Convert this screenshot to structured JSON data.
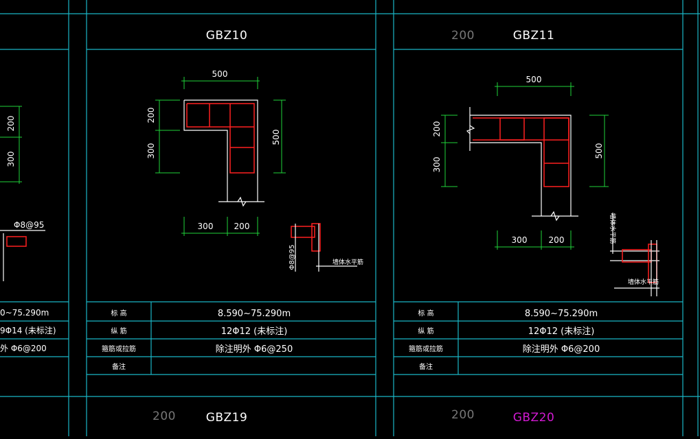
{
  "panels": {
    "left_partial": {
      "dims": [
        "200",
        "300"
      ],
      "rebar_note": "Φ8@95",
      "rows": [
        "0~75.290m",
        "9Φ14 (未标注)",
        "外 Φ6@200"
      ]
    },
    "gbz10": {
      "title": "GBZ10",
      "dims": {
        "top": "500",
        "left_upper": "200",
        "left_lower": "300",
        "right": "500",
        "bottom_left": "300",
        "bottom_right": "200"
      },
      "detail_label": "墙体水平筋",
      "detail_rebar": "Φ8@95",
      "table": {
        "labels": [
          "标 高",
          "纵 筋",
          "箍筋或拉筋",
          "备注"
        ],
        "values": [
          "8.590~75.290m",
          "12Φ12 (未标注)",
          "除注明外 Φ6@250",
          ""
        ]
      }
    },
    "gbz11": {
      "title": "GBZ11",
      "tag": "200",
      "dims": {
        "top": "500",
        "left_upper": "200",
        "left_lower": "300",
        "right": "500",
        "bottom_left": "300",
        "bottom_right": "200"
      },
      "detail_label_a": "墙体水平筋",
      "detail_label_b": "墙体水平筋",
      "table": {
        "labels": [
          "标 高",
          "纵 筋",
          "箍筋或拉筋",
          "备注"
        ],
        "values": [
          "8.590~75.290m",
          "12Φ12 (未标注)",
          "除注明外 Φ6@200",
          ""
        ]
      }
    },
    "gbz19": {
      "title": "GBZ19",
      "tag": "200"
    },
    "gbz20": {
      "title": "GBZ20",
      "tag": "200",
      "color": "#d21ad2"
    }
  }
}
